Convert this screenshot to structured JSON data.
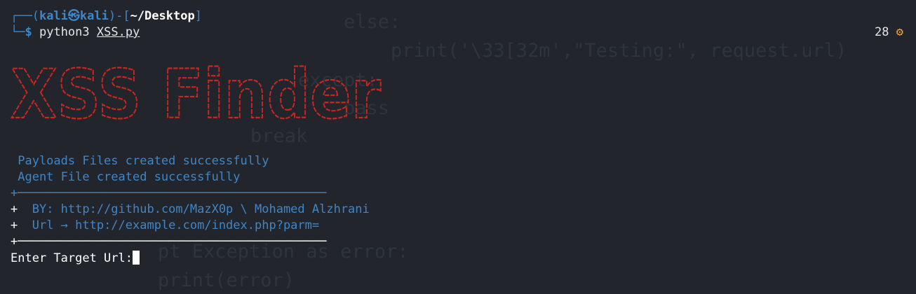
{
  "background_code": [
    {
      "text": "else:"
    },
    {
      "text": "print('\\33[32m',\"Testing:\", request.url)"
    },
    {
      "text": "except:"
    },
    {
      "text": "pass"
    },
    {
      "text": "break"
    },
    {
      "text": "pt Exception as error:"
    },
    {
      "text": "print(error)"
    }
  ],
  "prompt": {
    "frame_open": "┌──(",
    "user": "kali",
    "at_symbol": "㉿",
    "host": "kali",
    "frame_mid": ")-[",
    "cwd": "~/Desktop",
    "frame_close": "]",
    "frame_bottom": "└─",
    "symbol": "$",
    "command": "python3",
    "argument": "XSS.py"
  },
  "job_indicator": {
    "count": "28",
    "icon": "gear-icon"
  },
  "banner": {
    "text": "XSS Finder",
    "color": "#c8261f"
  },
  "output": {
    "payloads_msg": " Payloads Files created successfully",
    "agent_msg": " Agent File created successfully",
    "rule_top": "+───────────────────────────────────────────",
    "by_plus": "+",
    "by_line": "  BY: http://github.com/MazX0p \\ Mohamed Alzhrani",
    "url_plus": "+",
    "url_line": "  Url → http://example.com/index.php?parm=",
    "rule_bottom": "+───────────────────────────────────────────",
    "input_label": "Enter Target Url:"
  },
  "colors": {
    "background": "#22252c",
    "prompt_blue": "#3f86c8",
    "banner_red": "#c8261f",
    "text": "#e6e6e6",
    "gear_orange": "#f0a63c"
  }
}
